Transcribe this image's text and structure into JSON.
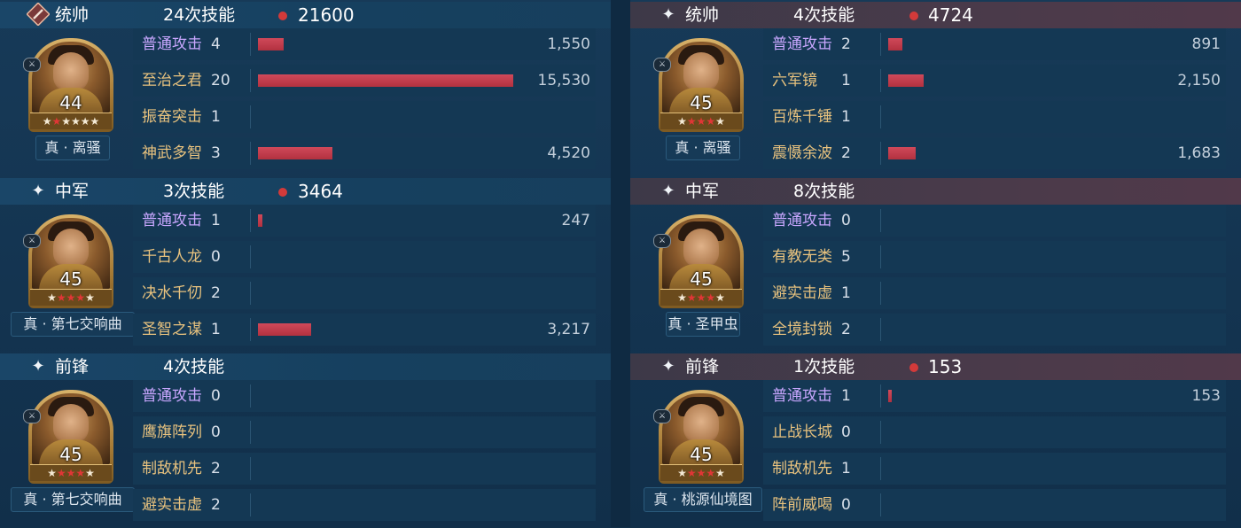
{
  "columns": [
    {
      "side": "left",
      "sections": [
        {
          "role": "统帅",
          "role_icon": "sword-icon",
          "skill_count": "24次技能",
          "total_damage": "21600",
          "level": "44",
          "stars_red": 1,
          "stars_white": 5,
          "treasure": "真 · 离骚",
          "skills": [
            {
              "name": "普通攻击",
              "count": "4",
              "damage": "1,550",
              "bar": 0.1,
              "normal": true
            },
            {
              "name": "至治之君",
              "count": "20",
              "damage": "15,530",
              "bar": 1.0,
              "normal": false
            },
            {
              "name": "振奋突击",
              "count": "1",
              "damage": "",
              "bar": 0,
              "normal": false
            },
            {
              "name": "神武多智",
              "count": "3",
              "damage": "4,520",
              "bar": 0.29,
              "normal": false
            }
          ]
        },
        {
          "role": "中军",
          "role_icon": "sparkle-icon",
          "skill_count": "3次技能",
          "total_damage": "3464",
          "level": "45",
          "stars_red": 3,
          "stars_white": 2,
          "treasure": "真 · 第七交响曲",
          "skills": [
            {
              "name": "普通攻击",
              "count": "1",
              "damage": "247",
              "bar": 0.016,
              "normal": true
            },
            {
              "name": "千古人龙",
              "count": "0",
              "damage": "",
              "bar": 0,
              "normal": false
            },
            {
              "name": "决水千仞",
              "count": "2",
              "damage": "",
              "bar": 0,
              "normal": false
            },
            {
              "name": "圣智之谋",
              "count": "1",
              "damage": "3,217",
              "bar": 0.21,
              "normal": false
            }
          ]
        },
        {
          "role": "前锋",
          "role_icon": "sparkle-icon",
          "skill_count": "4次技能",
          "total_damage": "",
          "level": "45",
          "stars_red": 3,
          "stars_white": 2,
          "treasure": "真 · 第七交响曲",
          "skills": [
            {
              "name": "普通攻击",
              "count": "0",
              "damage": "",
              "bar": 0,
              "normal": true
            },
            {
              "name": "鹰旗阵列",
              "count": "0",
              "damage": "",
              "bar": 0,
              "normal": false
            },
            {
              "name": "制敌机先",
              "count": "2",
              "damage": "",
              "bar": 0,
              "normal": false
            },
            {
              "name": "避实击虚",
              "count": "2",
              "damage": "",
              "bar": 0,
              "normal": false
            }
          ]
        }
      ]
    },
    {
      "side": "right",
      "sections": [
        {
          "role": "统帅",
          "role_icon": "sparkle-icon",
          "skill_count": "4次技能",
          "total_damage": "4724",
          "level": "45",
          "stars_red": 3,
          "stars_white": 2,
          "treasure": "真 · 离骚",
          "skills": [
            {
              "name": "普通攻击",
              "count": "2",
              "damage": "891",
              "bar": 0.057,
              "normal": true
            },
            {
              "name": "六军镜",
              "count": "1",
              "damage": "2,150",
              "bar": 0.138,
              "normal": false
            },
            {
              "name": "百炼千锤",
              "count": "1",
              "damage": "",
              "bar": 0,
              "normal": false
            },
            {
              "name": "震慑余波",
              "count": "2",
              "damage": "1,683",
              "bar": 0.108,
              "normal": false
            }
          ]
        },
        {
          "role": "中军",
          "role_icon": "sparkle-icon",
          "skill_count": "8次技能",
          "total_damage": "",
          "level": "45",
          "stars_red": 3,
          "stars_white": 2,
          "treasure": "真 · 圣甲虫",
          "skills": [
            {
              "name": "普通攻击",
              "count": "0",
              "damage": "",
              "bar": 0,
              "normal": true
            },
            {
              "name": "有教无类",
              "count": "5",
              "damage": "",
              "bar": 0,
              "normal": false
            },
            {
              "name": "避实击虚",
              "count": "1",
              "damage": "",
              "bar": 0,
              "normal": false
            },
            {
              "name": "全境封锁",
              "count": "2",
              "damage": "",
              "bar": 0,
              "normal": false
            }
          ]
        },
        {
          "role": "前锋",
          "role_icon": "sparkle-icon",
          "skill_count": "1次技能",
          "total_damage": "153",
          "level": "45",
          "stars_red": 3,
          "stars_white": 2,
          "treasure": "真 · 桃源仙境图",
          "skills": [
            {
              "name": "普通攻击",
              "count": "1",
              "damage": "153",
              "bar": 0.01,
              "normal": true
            },
            {
              "name": "止战长城",
              "count": "0",
              "damage": "",
              "bar": 0,
              "normal": false
            },
            {
              "name": "制敌机先",
              "count": "1",
              "damage": "",
              "bar": 0,
              "normal": false
            },
            {
              "name": "阵前威喝",
              "count": "0",
              "damage": "",
              "bar": 0,
              "normal": false
            }
          ]
        }
      ]
    }
  ],
  "colors": {
    "left_header": "#1a4668",
    "right_header": "#4a3a4a",
    "damage_bar": "#c13d4d",
    "damage_dot": "#d23a3a",
    "normal_attack_text": "#c9a7ff",
    "skill_text": "#e8c27e"
  }
}
